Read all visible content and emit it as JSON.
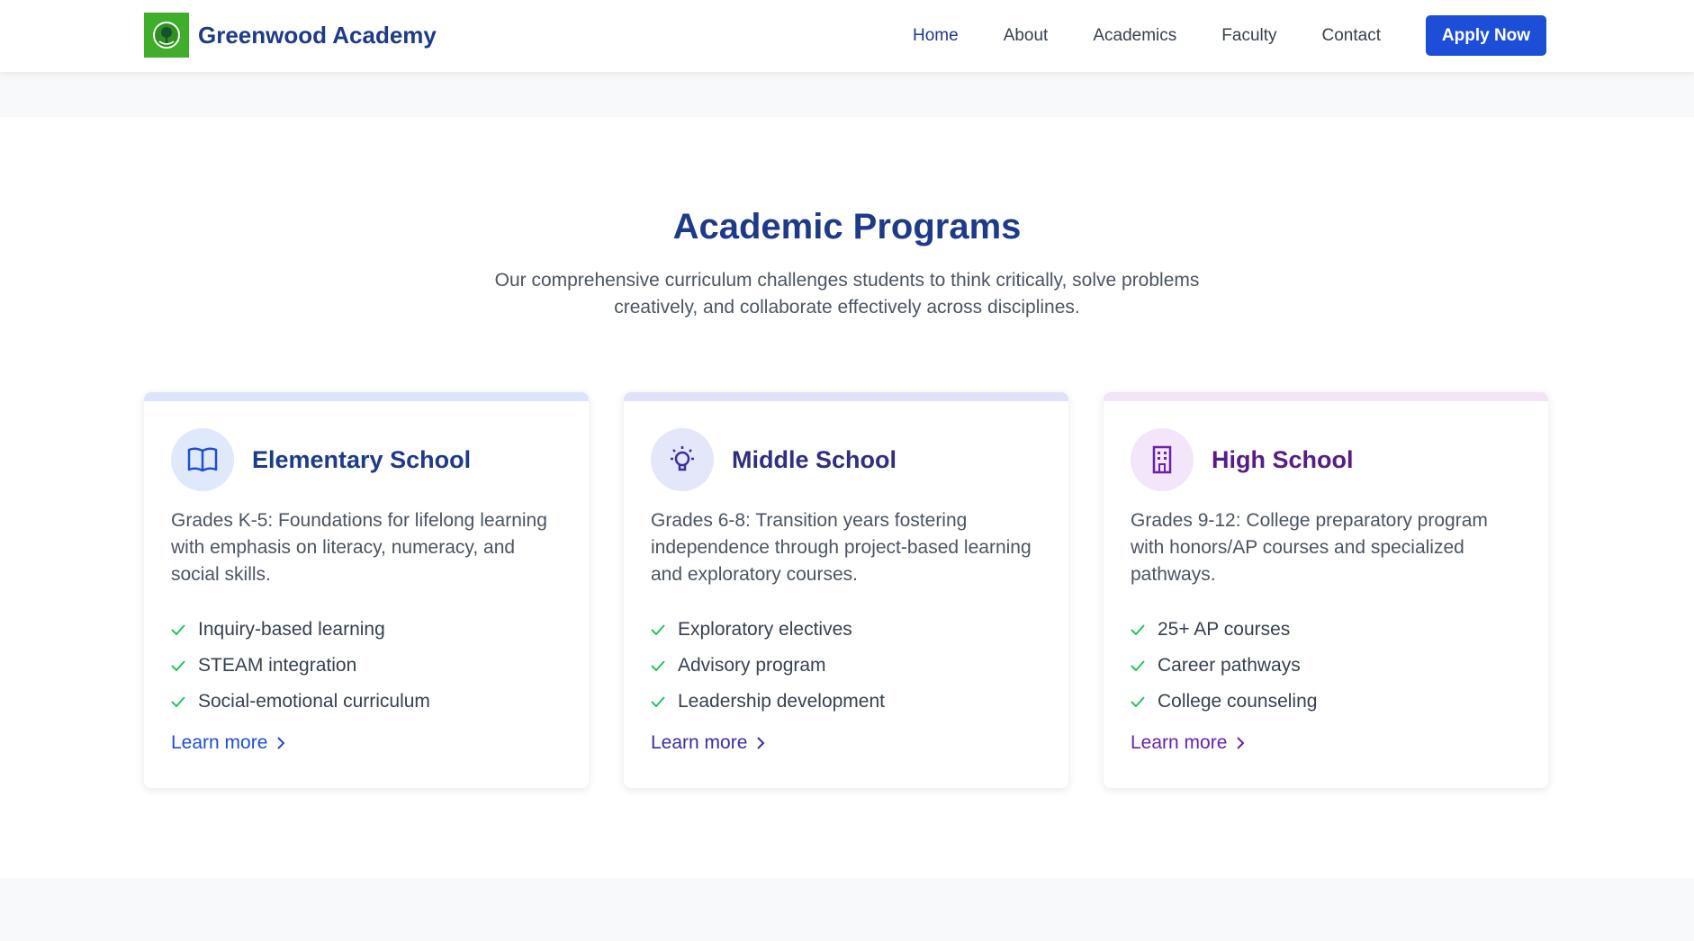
{
  "header": {
    "brand_name": "Greenwood Academy",
    "nav": [
      "Home",
      "About",
      "Academics",
      "Faculty",
      "Contact"
    ],
    "apply_label": "Apply Now"
  },
  "programs": {
    "title": "Academic Programs",
    "subtitle": "Our comprehensive curriculum challenges students to think critically, solve problems creatively, and collaborate effectively across disciplines.",
    "cards": [
      {
        "title": "Elementary School",
        "icon": "book-icon",
        "description": "Grades K-5: Foundations for lifelong learning with emphasis on literacy, numeracy, and social skills.",
        "features": [
          "Inquiry-based learning",
          "STEAM integration",
          "Social-emotional curriculum"
        ],
        "link": "Learn more",
        "accent": "#1d4ed8"
      },
      {
        "title": "Middle School",
        "icon": "lightbulb-icon",
        "description": "Grades 6-8: Transition years fostering independence through project-based learning and exploratory courses.",
        "features": [
          "Exploratory electives",
          "Advisory program",
          "Leadership development"
        ],
        "link": "Learn more",
        "accent": "#3730a3"
      },
      {
        "title": "High School",
        "icon": "building-icon",
        "description": "Grades 9-12: College preparatory program with honors/AP courses and specialized pathways.",
        "features": [
          "25+ AP courses",
          "Career pathways",
          "College counseling"
        ],
        "link": "Learn more",
        "accent": "#6b21a8"
      }
    ]
  },
  "colors": {
    "primary": "#1e3a8a",
    "button": "#1d4ed8",
    "check": "#22c55e",
    "logo_bg": "#3fae2a"
  }
}
